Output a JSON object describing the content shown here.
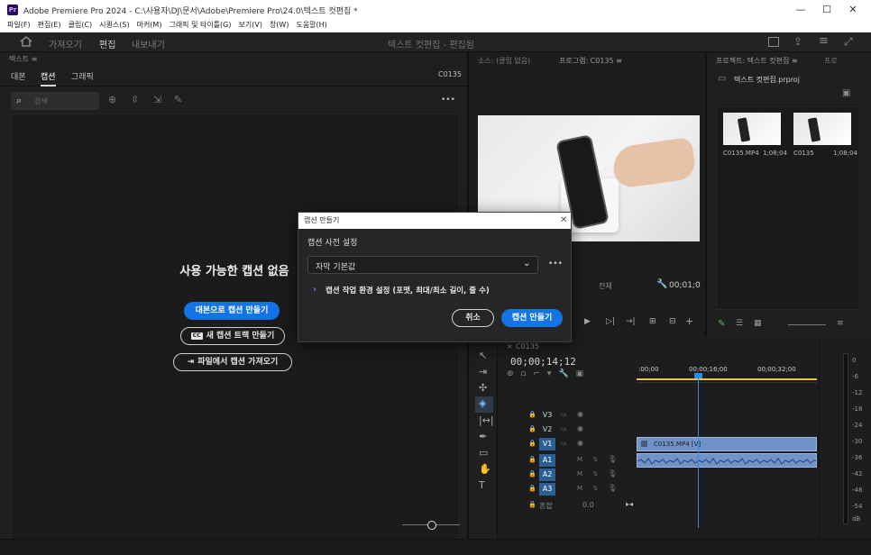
{
  "window": {
    "title": "Adobe Premiere Pro 2024 - C:\\사용자\\DJ\\문서\\Adobe\\Premiere Pro\\24.0\\텍스트 컷편집 *",
    "app_icon": "Pr",
    "minimize": "—",
    "maximize": "☐",
    "close": "✕"
  },
  "menu": [
    "파일(F)",
    "편집(E)",
    "클립(C)",
    "시퀀스(S)",
    "마커(M)",
    "그래픽 및 타이틀(G)",
    "보기(V)",
    "창(W)",
    "도움말(H)"
  ],
  "header": {
    "workspaces": [
      "가져오기",
      "편집",
      "내보내기"
    ],
    "active_workspace": "편집",
    "document_title": "텍스트 컷편집 - 편집됨"
  },
  "text_panel": {
    "header": "텍스트 ≡",
    "tabs": [
      "대본",
      "캡션",
      "그래픽"
    ],
    "active_tab": "캡션",
    "sequence": "C0135",
    "search_placeholder": "검색",
    "empty_title": "사용 가능한 캡션 없음",
    "btn_from_transcript": "대본으로 캡션 만들기",
    "btn_new_track": "새 캡션 트랙 만들기",
    "btn_new_track_icon": "CC",
    "btn_import": "파일에서 캡션 가져오기",
    "more": "•••"
  },
  "monitor": {
    "source_tab": "소스: (클립 없음)",
    "program_tab": "프로그램: C0135 ≡",
    "fit_label": "전체",
    "duration": "00;01;0"
  },
  "project": {
    "tab1": "프로젝트: 텍스트 컷편집 ≡",
    "tab2": "프로",
    "bin_name": "텍스트 컷편집.prproj",
    "items": [
      {
        "name": "C0135.MP4",
        "duration": "1;08;04"
      },
      {
        "name": "C0135",
        "duration": "1;08;04"
      }
    ]
  },
  "timeline": {
    "tab": "C0135",
    "timecode": "00;00;14;12",
    "ruler": [
      ":00;00",
      "00;00;16;00",
      "00;00;32;00"
    ],
    "video_tracks": [
      "V3",
      "V2",
      "V1"
    ],
    "audio_tracks": [
      "A1",
      "A2",
      "A3"
    ],
    "mix_label": "혼합",
    "mix_value": "0.0",
    "clip_name": "C0135.MP4 [V]"
  },
  "meters": {
    "scale": [
      "0",
      "-6",
      "-12",
      "-18",
      "-24",
      "-30",
      "-36",
      "-42",
      "-48",
      "-54",
      "dB"
    ]
  },
  "dialog": {
    "title": "캡션 만들기",
    "section": "캡션 사전 설정",
    "preset": "자막 기본값",
    "advanced": "캡션 작업 환경 설정 (포맷, 최대/최소 길이, 줄 수)",
    "cancel": "취소",
    "create": "캡션 만들기",
    "more": "•••"
  },
  "colors": {
    "accent_blue": "#1473e6",
    "track_blue": "#2c5f96",
    "clip_blue": "#6f93c9",
    "playhead": "#2d8ceb",
    "work_area": "#e8c33b"
  }
}
